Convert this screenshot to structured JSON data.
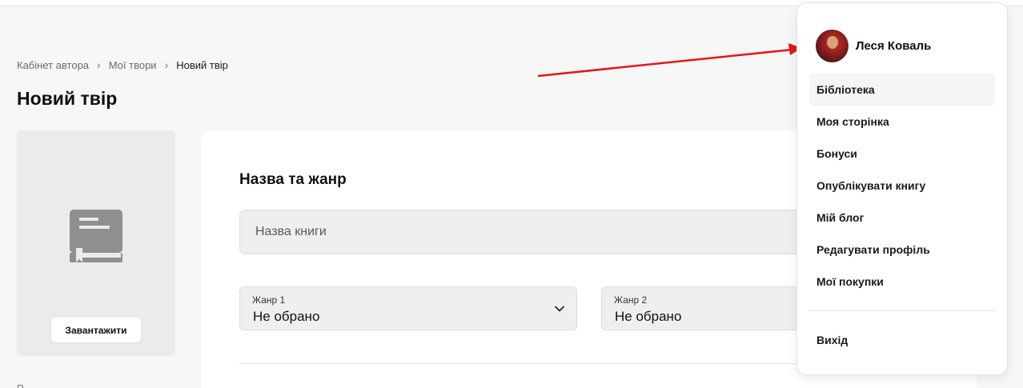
{
  "breadcrumb": {
    "item1": "Кабінет автора",
    "item2": "Мої твори",
    "current": "Новий твір",
    "separator": "›"
  },
  "page": {
    "title": "Новий твір"
  },
  "cover": {
    "upload_label": "Завантажити",
    "icon": "book-icon"
  },
  "form": {
    "section_title": "Назва та жанр",
    "name_placeholder": "Назва книги",
    "genre1": {
      "label": "Жанр 1",
      "value": "Не обрано"
    },
    "genre2": {
      "label": "Жанр 2",
      "value": "Не обрано"
    }
  },
  "user_menu": {
    "user_name": "Леся Коваль",
    "items": [
      {
        "label": "Бібліотека"
      },
      {
        "label": "Моя сторінка"
      },
      {
        "label": "Бонуси"
      },
      {
        "label": "Опублікувати книгу"
      },
      {
        "label": "Мій блог"
      },
      {
        "label": "Редагувати профіль"
      },
      {
        "label": "Мої покупки"
      }
    ],
    "logout_label": "Вихід"
  },
  "annotation": {
    "arrow_color": "#e8131b"
  }
}
